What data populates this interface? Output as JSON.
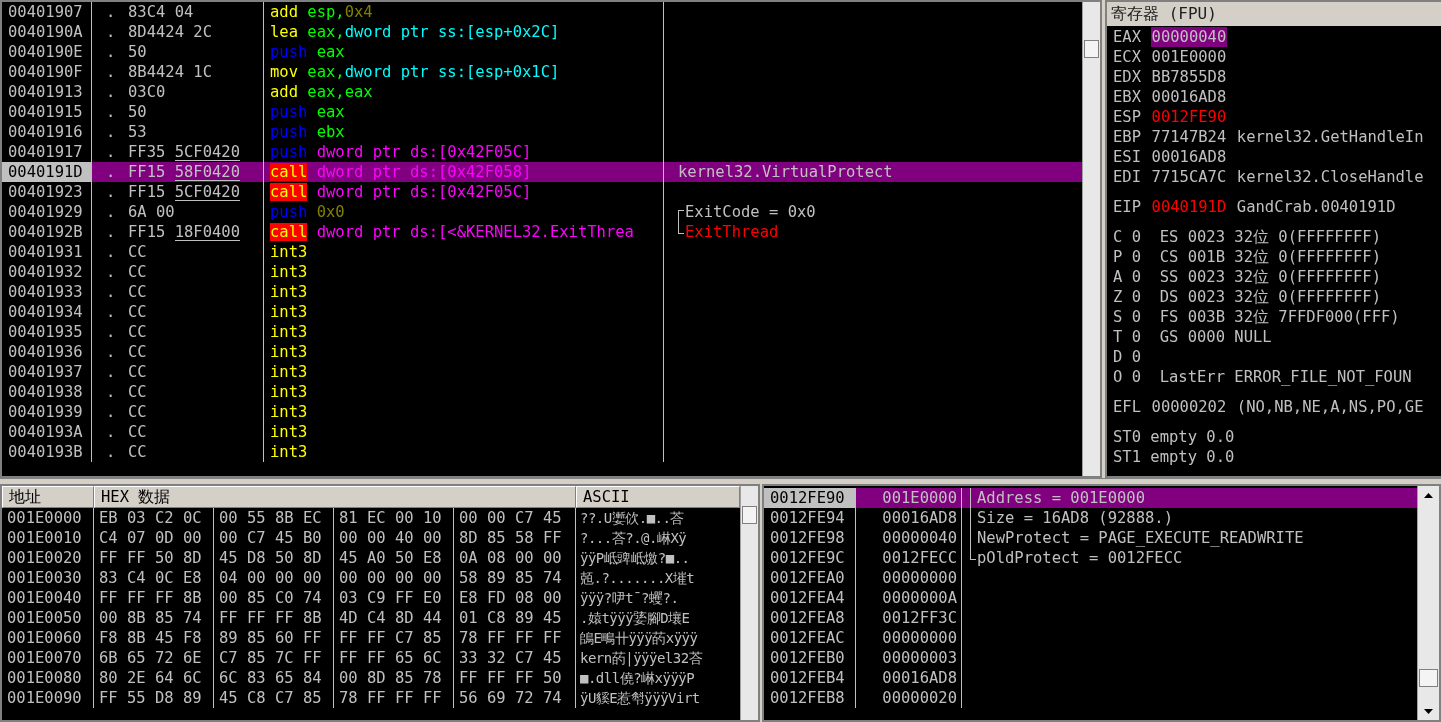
{
  "disassembly": {
    "rows": [
      {
        "address": "00401907",
        "mark": ".",
        "hex": "83C4 04",
        "selected": false,
        "instruction": [
          {
            "text": "add",
            "kind": "op"
          },
          {
            "text": " esp,",
            "kind": "reg"
          },
          {
            "text": "0x4",
            "kind": "const"
          }
        ]
      },
      {
        "address": "0040190A",
        "mark": ".",
        "hex": "8D4424 2C",
        "selected": false,
        "instruction": [
          {
            "text": "lea",
            "kind": "op"
          },
          {
            "text": " eax,",
            "kind": "reg"
          },
          {
            "text": "dword ptr ss:[esp+0x2C]",
            "kind": "mem"
          }
        ]
      },
      {
        "address": "0040190E",
        "mark": ".",
        "hex": "50",
        "selected": false,
        "instruction": [
          {
            "text": "push",
            "kind": "push"
          },
          {
            "text": " eax",
            "kind": "reg"
          }
        ]
      },
      {
        "address": "0040190F",
        "mark": ".",
        "hex": "8B4424 1C",
        "selected": false,
        "instruction": [
          {
            "text": "mov",
            "kind": "op"
          },
          {
            "text": " eax,",
            "kind": "reg"
          },
          {
            "text": "dword ptr ss:[esp+0x1C]",
            "kind": "mem"
          }
        ]
      },
      {
        "address": "00401913",
        "mark": ".",
        "hex": "03C0",
        "selected": false,
        "instruction": [
          {
            "text": "add",
            "kind": "op"
          },
          {
            "text": " eax,eax",
            "kind": "reg"
          }
        ]
      },
      {
        "address": "00401915",
        "mark": ".",
        "hex": "50",
        "selected": false,
        "instruction": [
          {
            "text": "push",
            "kind": "push"
          },
          {
            "text": " eax",
            "kind": "reg"
          }
        ]
      },
      {
        "address": "00401916",
        "mark": ".",
        "hex": "53",
        "selected": false,
        "instruction": [
          {
            "text": "push",
            "kind": "push"
          },
          {
            "text": " ebx",
            "kind": "reg"
          }
        ]
      },
      {
        "address": "00401917",
        "mark": ".",
        "hex": "FF35 ",
        "operand": "5CF0420",
        "selected": false,
        "instruction": [
          {
            "text": "push",
            "kind": "push"
          },
          {
            "text": " dword ptr ds:[0x42F05C]",
            "kind": "ptr"
          }
        ]
      },
      {
        "address": "0040191D",
        "mark": ".",
        "hex": "FF15 ",
        "operand": "58F0420",
        "selected": true,
        "instruction": [
          {
            "text": "call",
            "kind": "call"
          },
          {
            "text": " dword ptr ds:[0x42F058]",
            "kind": "ptr"
          }
        ],
        "comment": {
          "text": "kernel32.VirtualProtect",
          "kind": "note"
        }
      },
      {
        "address": "00401923",
        "mark": ".",
        "hex": "FF15 ",
        "operand": "5CF0420",
        "selected": false,
        "instruction": [
          {
            "text": "call",
            "kind": "call"
          },
          {
            "text": " dword ptr ds:[0x42F05C]",
            "kind": "ptr"
          }
        ]
      },
      {
        "address": "00401929",
        "mark": ".",
        "hex": "6A 00",
        "selected": false,
        "instruction": [
          {
            "text": "push",
            "kind": "push"
          },
          {
            "text": " 0x0",
            "kind": "const"
          }
        ],
        "comment": {
          "text": "ExitCode = 0x0",
          "kind": "argfirst"
        }
      },
      {
        "address": "0040192B",
        "mark": ".",
        "hex": "FF15 ",
        "operand": "18F0400",
        "selected": false,
        "instruction": [
          {
            "text": "call",
            "kind": "call"
          },
          {
            "text": " dword ptr ds:[<&KERNEL32.ExitThrea",
            "kind": "ptr"
          }
        ],
        "comment": {
          "text": "ExitThread",
          "kind": "apilast"
        }
      },
      {
        "address": "00401931",
        "mark": ".",
        "hex": "CC",
        "selected": false,
        "instruction": [
          {
            "text": "int3",
            "kind": "op"
          }
        ]
      },
      {
        "address": "00401932",
        "mark": ".",
        "hex": "CC",
        "selected": false,
        "instruction": [
          {
            "text": "int3",
            "kind": "op"
          }
        ]
      },
      {
        "address": "00401933",
        "mark": ".",
        "hex": "CC",
        "selected": false,
        "instruction": [
          {
            "text": "int3",
            "kind": "op"
          }
        ]
      },
      {
        "address": "00401934",
        "mark": ".",
        "hex": "CC",
        "selected": false,
        "instruction": [
          {
            "text": "int3",
            "kind": "op"
          }
        ]
      },
      {
        "address": "00401935",
        "mark": ".",
        "hex": "CC",
        "selected": false,
        "instruction": [
          {
            "text": "int3",
            "kind": "op"
          }
        ]
      },
      {
        "address": "00401936",
        "mark": ".",
        "hex": "CC",
        "selected": false,
        "instruction": [
          {
            "text": "int3",
            "kind": "op"
          }
        ]
      },
      {
        "address": "00401937",
        "mark": ".",
        "hex": "CC",
        "selected": false,
        "instruction": [
          {
            "text": "int3",
            "kind": "op"
          }
        ]
      },
      {
        "address": "00401938",
        "mark": ".",
        "hex": "CC",
        "selected": false,
        "instruction": [
          {
            "text": "int3",
            "kind": "op"
          }
        ]
      },
      {
        "address": "00401939",
        "mark": ".",
        "hex": "CC",
        "selected": false,
        "instruction": [
          {
            "text": "int3",
            "kind": "op"
          }
        ]
      },
      {
        "address": "0040193A",
        "mark": ".",
        "hex": "CC",
        "selected": false,
        "instruction": [
          {
            "text": "int3",
            "kind": "op"
          }
        ]
      },
      {
        "address": "0040193B",
        "mark": ".",
        "hex": "CC",
        "selected": false,
        "instruction": [
          {
            "text": "int3",
            "kind": "op"
          }
        ]
      }
    ]
  },
  "registers": {
    "title": "寄存器 (FPU)",
    "groups": [
      {
        "lines": [
          {
            "kind": "reg",
            "name": "EAX",
            "value": "00000040",
            "selected": true,
            "changed": false
          },
          {
            "kind": "reg",
            "name": "ECX",
            "value": "001E0000",
            "selected": false,
            "changed": false
          },
          {
            "kind": "reg",
            "name": "EDX",
            "value": "BB7855D8",
            "selected": false,
            "changed": false
          },
          {
            "kind": "reg",
            "name": "EBX",
            "value": "00016AD8",
            "selected": false,
            "changed": false
          },
          {
            "kind": "reg",
            "name": "ESP",
            "value": "0012FE90",
            "selected": false,
            "changed": true
          },
          {
            "kind": "reg",
            "name": "EBP",
            "value": "77147B24",
            "comment": "kernel32.GetHandleIn",
            "selected": false,
            "changed": false
          },
          {
            "kind": "reg",
            "name": "ESI",
            "value": "00016AD8",
            "selected": false,
            "changed": false
          },
          {
            "kind": "reg",
            "name": "EDI",
            "value": "7715CA7C",
            "comment": "kernel32.CloseHandle",
            "selected": false,
            "changed": false
          }
        ]
      },
      {
        "lines": [
          {
            "kind": "reg",
            "name": "EIP",
            "value": "0040191D",
            "comment": "GandCrab.0040191D",
            "selected": false,
            "changed": true
          }
        ]
      },
      {
        "lines": [
          {
            "kind": "text",
            "text": "C 0  ES 0023 32位 0(FFFFFFFF)"
          },
          {
            "kind": "text",
            "text": "P 0  CS 001B 32位 0(FFFFFFFF)"
          },
          {
            "kind": "text",
            "text": "A 0  SS 0023 32位 0(FFFFFFFF)"
          },
          {
            "kind": "text",
            "text": "Z 0  DS 0023 32位 0(FFFFFFFF)"
          },
          {
            "kind": "text",
            "text": "S 0  FS 003B 32位 7FFDF000(FFF)"
          },
          {
            "kind": "text",
            "text": "T 0  GS 0000 NULL"
          },
          {
            "kind": "text",
            "text": "D 0"
          },
          {
            "kind": "text",
            "text": "O 0  LastErr ERROR_FILE_NOT_FOUN"
          }
        ]
      },
      {
        "lines": [
          {
            "kind": "reg",
            "name": "EFL",
            "value": "00000202",
            "comment": "(NO,NB,NE,A,NS,PO,GE",
            "selected": false,
            "changed": false
          }
        ]
      },
      {
        "lines": [
          {
            "kind": "text",
            "text": "ST0 empty 0.0"
          },
          {
            "kind": "text",
            "text": "ST1 empty 0.0"
          }
        ]
      }
    ]
  },
  "dump": {
    "columns": [
      "地址",
      "HEX 数据",
      "ASCII"
    ],
    "rows": [
      {
        "address": "001E0000",
        "hex": "EB 03 C2 0C 00 55 8B EC 81 EC 00 10 00 00 C7 45",
        "ascii": "??.U嬱佽.■..荅"
      },
      {
        "address": "001E0010",
        "hex": "C4 07 0D 00 00 C7 45 B0 00 00 40 00 8D 85 58 FF",
        "ascii": "?...荅?.@.崊Xÿ"
      },
      {
        "address": "001E0020",
        "hex": "FF FF 50 8D 45 D8 50 8D 45 A0 50 E8 0A 08 00 00",
        "ascii": "ÿÿP岻豍岻燩?■.."
      },
      {
        "address": "001E0030",
        "hex": "83 C4 0C E8 04 00 00 00 00 00 00 00 58 89 85 74",
        "ascii": "兡.?.......X墔t"
      },
      {
        "address": "001E0040",
        "hex": "FF FF FF 8B 00 85 C0 74 03 C9 FF E0 E8 FD 08 00",
        "ascii": "ÿÿÿ?吚t¯?蠼?."
      },
      {
        "address": "001E0050",
        "hex": "00 8B 85 74 FF FF FF 8B 4D C4 8D 44 01 C8 89 45",
        "ascii": ".媴tÿÿÿ婱腳D壤E"
      },
      {
        "address": "001E0060",
        "hex": "F8 8B 45 F8 89 85 60 FF FF FF C7 85 78 FF FF FF",
        "ascii": "鴭E鴫卄ÿÿÿ菂xÿÿÿ"
      },
      {
        "address": "001E0070",
        "hex": "6B 65 72 6E C7 85 7C FF FF FF 65 6C 33 32 C7 45",
        "ascii": "kern菂|ÿÿÿel32荅"
      },
      {
        "address": "001E0080",
        "hex": "80 2E 64 6C 6C 83 65 84 00 8D 85 78 FF FF FF 50",
        "ascii": "■.dll僥?崊xÿÿÿP"
      },
      {
        "address": "001E0090",
        "hex": "FF 55 D8 89 45 C8 C7 85 78 FF FF FF 56 69 72 74",
        "ascii": "ÿU貕E惹厁ÿÿÿVirt"
      }
    ]
  },
  "stack": {
    "rows": [
      {
        "address": "0012FE90",
        "value": "001E0000",
        "selected": true,
        "comment": {
          "text": "Address = 001E0000",
          "kind": "argmid"
        }
      },
      {
        "address": "0012FE94",
        "value": "00016AD8",
        "selected": false,
        "comment": {
          "text": "Size = 16AD8 (92888.)",
          "kind": "argmid"
        }
      },
      {
        "address": "0012FE98",
        "value": "00000040",
        "selected": false,
        "comment": {
          "text": "NewProtect = PAGE_EXECUTE_READWRITE",
          "kind": "argmid"
        }
      },
      {
        "address": "0012FE9C",
        "value": "0012FECC",
        "selected": false,
        "comment": {
          "text": "pOldProtect = 0012FECC",
          "kind": "arglast"
        }
      },
      {
        "address": "0012FEA0",
        "value": "00000000",
        "selected": false
      },
      {
        "address": "0012FEA4",
        "value": "0000000A",
        "selected": false
      },
      {
        "address": "0012FEA8",
        "value": "0012FF3C",
        "selected": false
      },
      {
        "address": "0012FEAC",
        "value": "00000000",
        "selected": false
      },
      {
        "address": "0012FEB0",
        "value": "00000003",
        "selected": false
      },
      {
        "address": "0012FEB4",
        "value": "00016AD8",
        "selected": false
      },
      {
        "address": "0012FEB8",
        "value": "00000020",
        "selected": false
      }
    ]
  }
}
